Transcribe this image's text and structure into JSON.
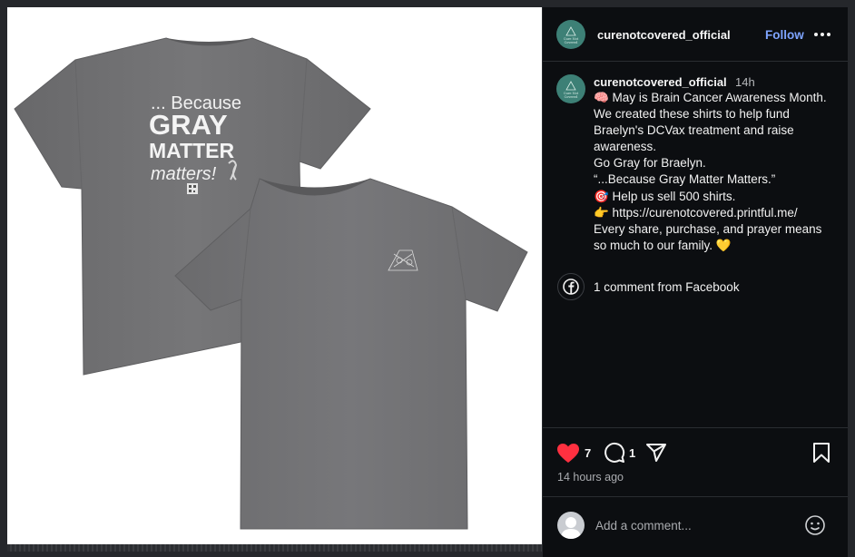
{
  "post": {
    "image": {
      "shirt_back_print": {
        "line1": "... Because",
        "line2": "GRAY",
        "line3": "MATTER",
        "line4": "matters!"
      }
    },
    "header": {
      "username": "curenotcovered_official",
      "follow_label": "Follow",
      "avatar_text": "Cure Not Covered"
    },
    "caption": {
      "username": "curenotcovered_official",
      "time": "14h",
      "lines": [
        "🧠 May is Brain Cancer Awareness Month.",
        "We created these shirts to help fund",
        "Braelyn's DCVax treatment and raise",
        "awareness.",
        "Go Gray for Braelyn.",
        "“...Because Gray Matter Matters.”",
        "🎯 Help us sell 500 shirts.",
        "👉 https://curenotcovered.printful.me/",
        "Every share, purchase, and prayer means",
        "so much to our family. 💛"
      ]
    },
    "facebook_comments": "1 comment from Facebook",
    "actions": {
      "like_count": "7",
      "comment_count": "1",
      "time_ago": "14 hours ago"
    },
    "comment_box": {
      "placeholder": "Add a comment..."
    }
  },
  "colors": {
    "accent_follow": "#7ea4ff",
    "like_heart": "#ff3040",
    "panel_bg": "#0c0e11",
    "shirt_gray": "#707072"
  },
  "icons": [
    "more-icon",
    "facebook-icon",
    "heart-icon",
    "comment-icon",
    "share-icon",
    "bookmark-icon",
    "emoji-icon",
    "user-icon"
  ]
}
